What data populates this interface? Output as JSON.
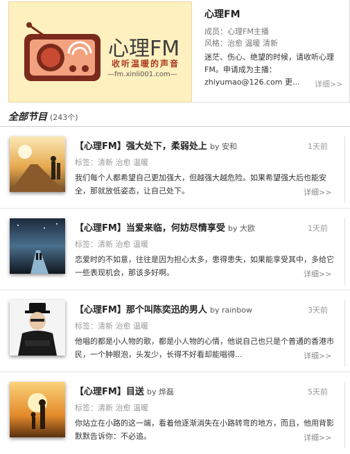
{
  "logo": {
    "title": "心理FM",
    "slogan": "收听温暖的声音",
    "url": "—fm.xinli001.com—"
  },
  "station": {
    "title": "心理FM",
    "owner_label": "成员：",
    "owner_value": "心理FM主播",
    "style_label": "风格：",
    "style_value": "治愈 温暖 清新",
    "description": "迷茫、伤心、绝望的时候，请收听心理FM。申请成为主播：zhiyumao@126.com 更...",
    "more": "详细>>"
  },
  "section": {
    "title": "全部节目",
    "count": "(243个)"
  },
  "items": [
    {
      "title": "【心理FM】强大处下，柔弱处上",
      "by": "by 安和",
      "time": "1天前",
      "tags": "标签：清新 治愈 温暖",
      "desc": "我们每个人都希望自己更加强大，但越强大越危险。如果希望强大后也能安全，那就放低姿态，让自己处下。",
      "more": "详细>>",
      "thumb_icon": "walking-couple-photo"
    },
    {
      "title": "【心理FM】当爱来临，何妨尽情享受",
      "by": "by 大欧",
      "time": "1天前",
      "tags": "标签：清新 治愈 温暖",
      "desc": "恋爱时的不如意，往往是因为担心太多，患得患失，如果能享受其中，多给它一些表现机会，那该多好啊。",
      "more": "详细>>",
      "thumb_icon": "night-path-photo"
    },
    {
      "title": "【心理FM】那个叫陈奕迅的男人",
      "by": "by rainbow",
      "time": "3天前",
      "tags": "标签：清新 治愈 温暖",
      "desc": "他唱的都是小人物的歌，都是小人物的心情，他说自己也只是个普通的香港市民，一个肿眼泡，头发少，长得不好看却能唱得...",
      "more": "详细>>",
      "thumb_icon": "singer-portrait-photo"
    },
    {
      "title": "【心理FM】目送",
      "by": "by 烨磊",
      "time": "5天前",
      "tags": "标签：清新 治愈 温暖",
      "desc": "你站立在小路的这一端，看着他逐渐消失在小路转弯的地方，而且，他用背影默默告诉你：不必追。",
      "more": "详细>>",
      "thumb_icon": "sunset-parent-child-photo"
    }
  ]
}
